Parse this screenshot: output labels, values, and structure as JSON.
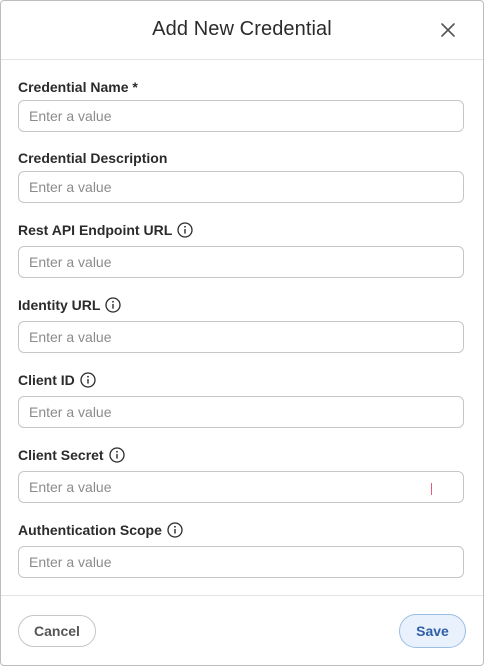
{
  "dialog": {
    "title": "Add New Credential",
    "close_icon": "close-icon"
  },
  "fields": [
    {
      "label": "Credential Name *",
      "placeholder": "Enter a value",
      "value": "",
      "info_icon": false
    },
    {
      "label": "Credential Description",
      "placeholder": "Enter a value",
      "value": "",
      "info_icon": false
    },
    {
      "label": "Rest API Endpoint URL",
      "placeholder": "Enter a value",
      "value": "",
      "info_icon": true
    },
    {
      "label": "Identity URL",
      "placeholder": "Enter a value",
      "value": "",
      "info_icon": true
    },
    {
      "label": "Client ID",
      "placeholder": "Enter a value",
      "value": "",
      "info_icon": true
    },
    {
      "label": "Client Secret",
      "placeholder": "Enter a value",
      "value": "",
      "info_icon": true
    },
    {
      "label": "Authentication Scope",
      "placeholder": "Enter a value",
      "value": "",
      "info_icon": true
    }
  ],
  "footer": {
    "cancel_label": "Cancel",
    "save_label": "Save"
  },
  "colors": {
    "save_bg": "#e9f2fc",
    "save_text": "#2e5fa8",
    "border": "#c6c6c6"
  }
}
